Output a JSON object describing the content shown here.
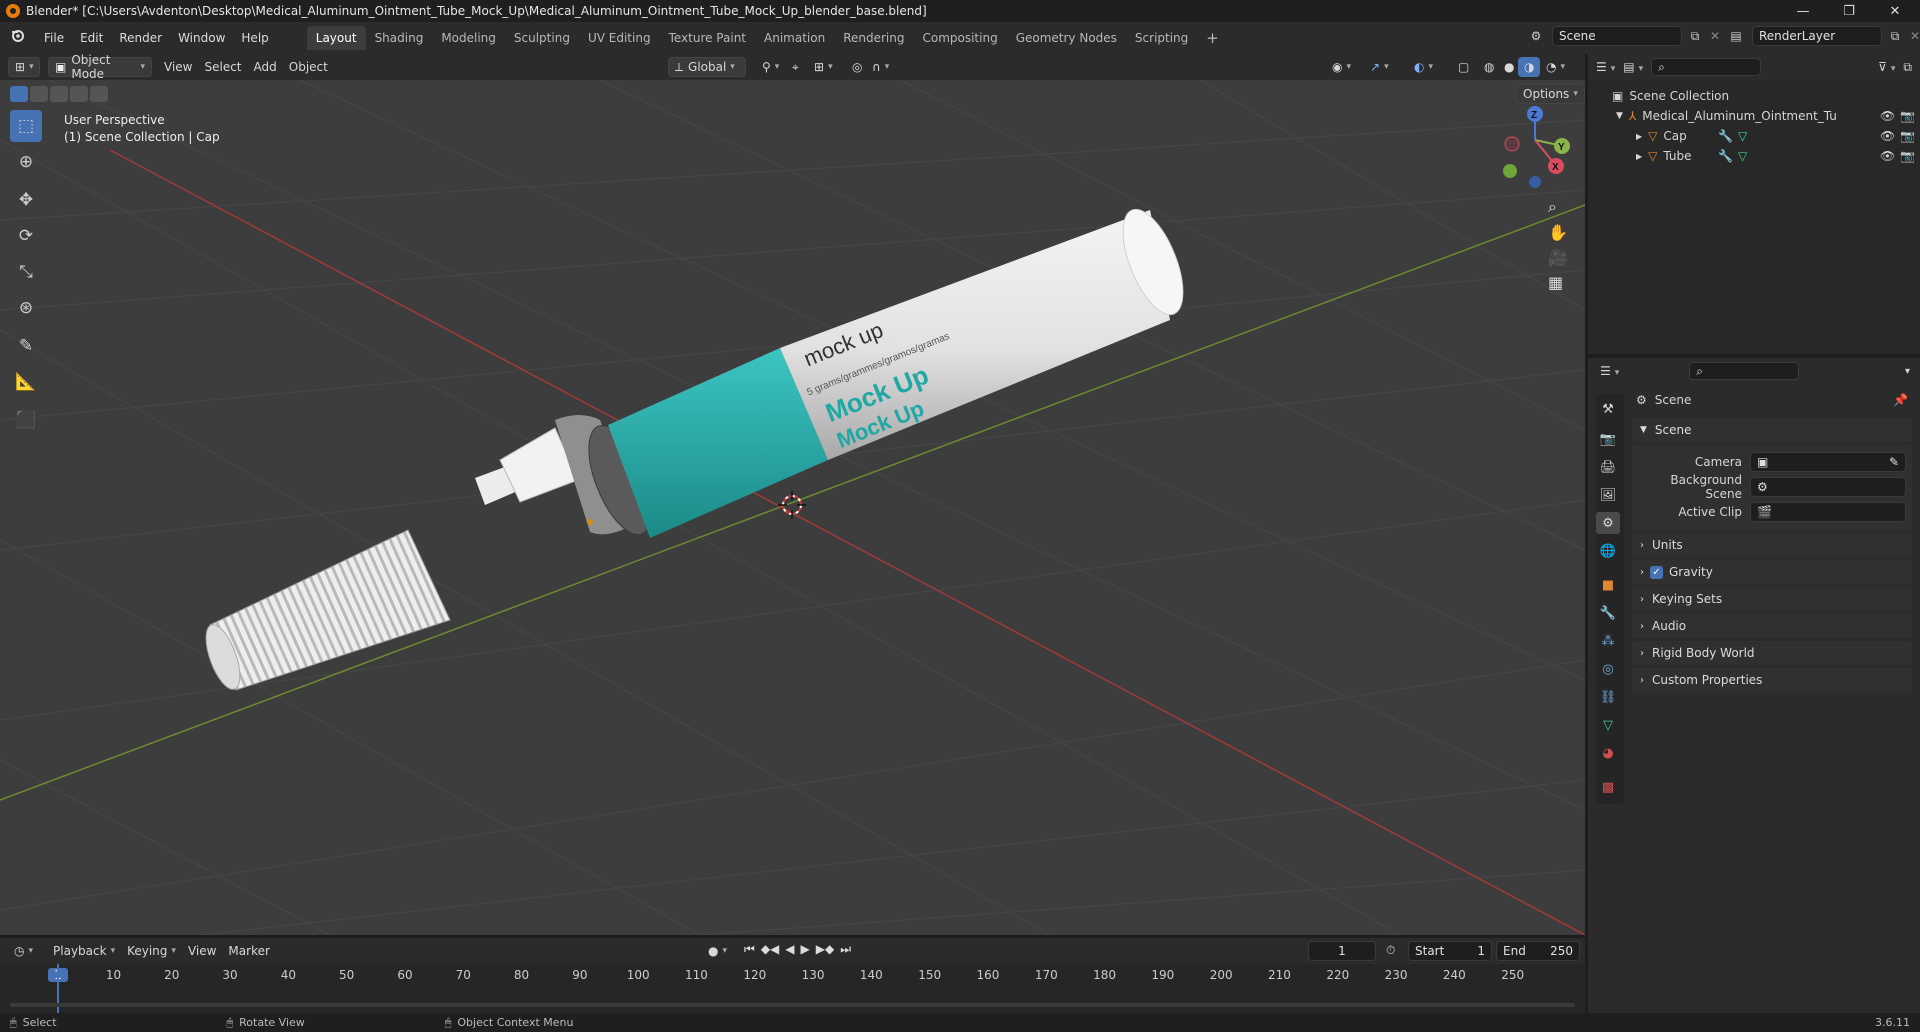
{
  "window": {
    "title": "Blender* [C:\\Users\\Avdenton\\Desktop\\Medical_Aluminum_Ointment_Tube_Mock_Up\\Medical_Aluminum_Ointment_Tube_Mock_Up_blender_base.blend]",
    "minimize": "—",
    "maximize": "❐",
    "close": "✕"
  },
  "menu": {
    "items": [
      "File",
      "Edit",
      "Render",
      "Window",
      "Help"
    ]
  },
  "workspaces": [
    "Layout",
    "Shading",
    "Modeling",
    "Sculpting",
    "UV Editing",
    "Texture Paint",
    "Animation",
    "Rendering",
    "Compositing",
    "Geometry Nodes",
    "Scripting"
  ],
  "workspace_add": "+",
  "scene": {
    "name": "Scene",
    "renderlayer": "RenderLayer"
  },
  "viewport_header": {
    "mode": "Object Mode",
    "menus": [
      "View",
      "Select",
      "Add",
      "Object"
    ],
    "orientation": "Global",
    "options": "Options"
  },
  "viewport": {
    "perspective": "User Perspective",
    "collection_info": "(1) Scene Collection | Cap"
  },
  "model_text": {
    "brand": "mock up",
    "weight": "5 grams/grammes/gramos/gramas",
    "label1": "Mock Up",
    "label2": "Mock Up"
  },
  "gizmo": {
    "x": "X",
    "y": "Y",
    "z": "Z"
  },
  "outliner": {
    "root": "Scene Collection",
    "collection": "Medical_Aluminum_Ointment_Tube_Mo",
    "objects": [
      "Cap",
      "Tube"
    ]
  },
  "properties": {
    "context": "Scene",
    "panel": "Scene",
    "camera_label": "Camera",
    "bg_label": "Background Scene",
    "clip_label": "Active Clip",
    "sections": [
      "Units",
      "Gravity",
      "Keying Sets",
      "Audio",
      "Rigid Body World",
      "Custom Properties"
    ],
    "gravity_checked": true
  },
  "timeline": {
    "menus": [
      "Playback",
      "Keying",
      "View",
      "Marker"
    ],
    "current": "1",
    "start_label": "Start",
    "start": "1",
    "end_label": "End",
    "end": "250",
    "ticks": [
      "1",
      "10",
      "20",
      "30",
      "40",
      "50",
      "60",
      "70",
      "80",
      "90",
      "100",
      "110",
      "120",
      "130",
      "140",
      "150",
      "160",
      "170",
      "180",
      "190",
      "200",
      "210",
      "220",
      "230",
      "240",
      "250"
    ]
  },
  "status": {
    "select": "Select",
    "rotate": "Rotate View",
    "context": "Object Context Menu",
    "version": "3.6.11"
  }
}
